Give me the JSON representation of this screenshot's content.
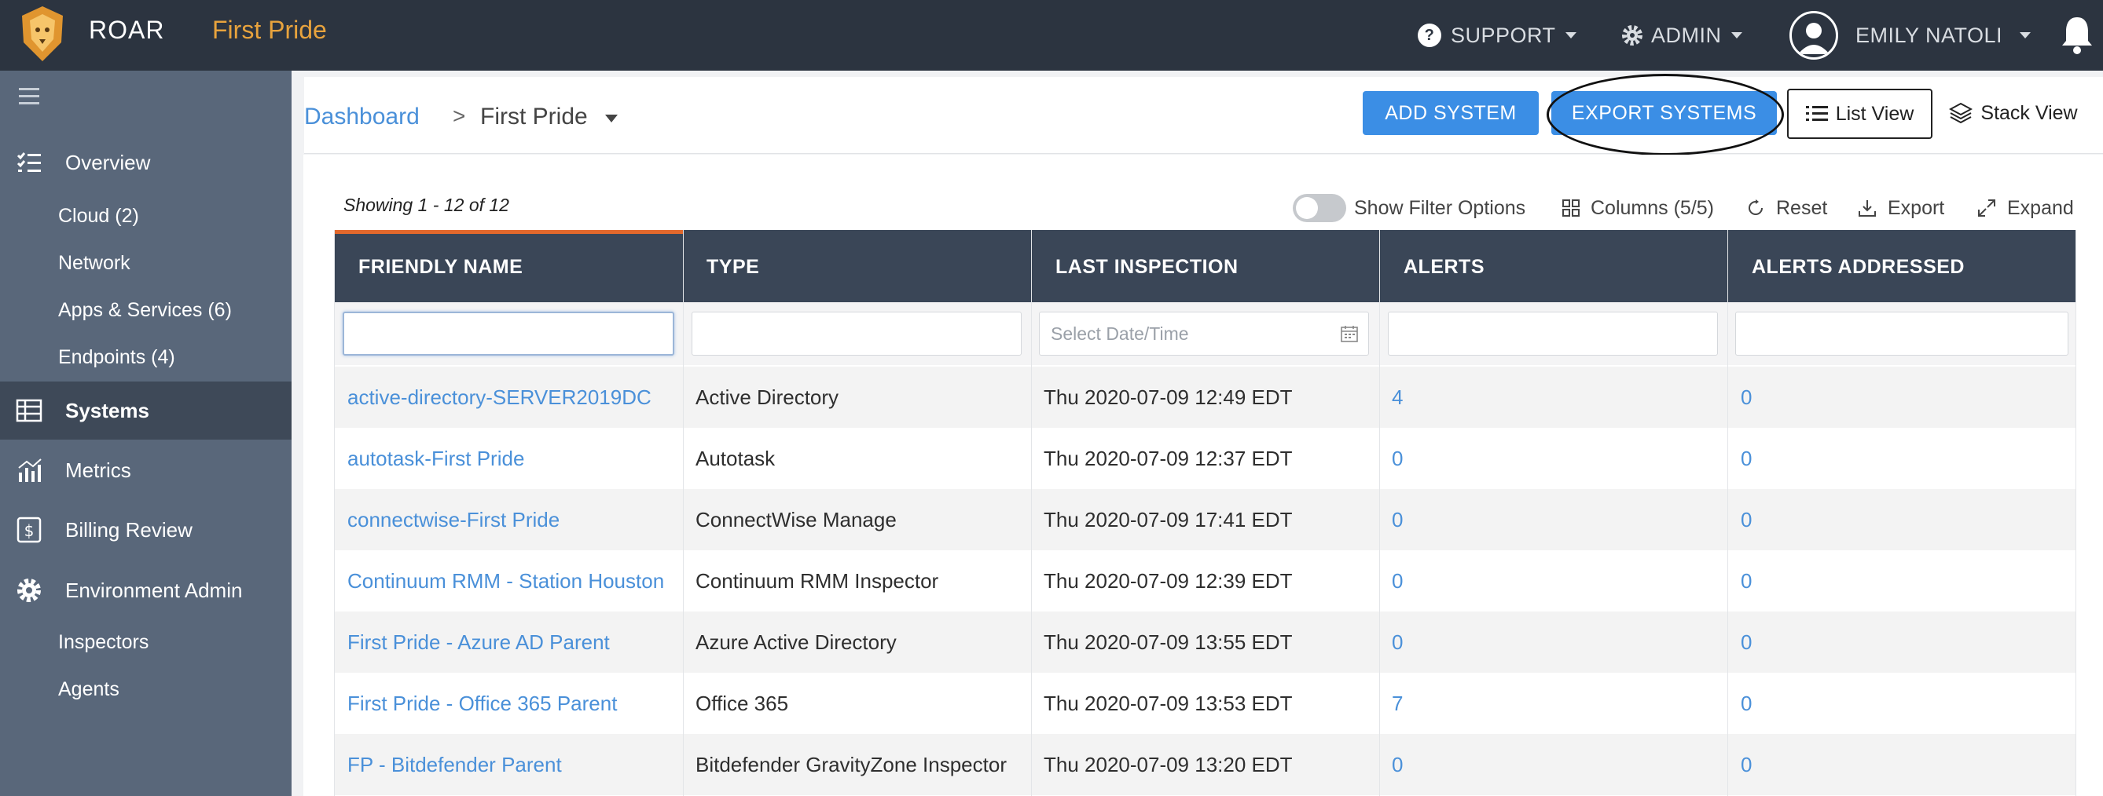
{
  "app": {
    "brand": "ROAR",
    "org": "First Pride"
  },
  "topnav": {
    "support": "SUPPORT",
    "admin": "ADMIN",
    "user": "EMILY NATOLI"
  },
  "sidebar": {
    "overview": "Overview",
    "sub_overview": [
      "Cloud (2)",
      "Network",
      "Apps & Services (6)",
      "Endpoints (4)"
    ],
    "systems": "Systems",
    "metrics": "Metrics",
    "billing": "Billing Review",
    "env_admin": "Environment Admin",
    "sub_env": [
      "Inspectors",
      "Agents"
    ]
  },
  "breadcrumb": {
    "root": "Dashboard",
    "sep": ">",
    "current": "First Pride"
  },
  "actions": {
    "add": "ADD SYSTEM",
    "export": "EXPORT SYSTEMS",
    "list_view": "List View",
    "stack_view": "Stack View"
  },
  "toolbar": {
    "showing": "Showing 1 - 12 of 12",
    "filter": "Show Filter Options",
    "columns": "Columns (5/5)",
    "reset": "Reset",
    "export": "Export",
    "expand": "Expand"
  },
  "table": {
    "headers": [
      "FRIENDLY NAME",
      "TYPE",
      "LAST INSPECTION",
      "ALERTS",
      "ALERTS ADDRESSED"
    ],
    "date_placeholder": "Select Date/Time",
    "rows": [
      {
        "name": "active-directory-SERVER2019DC",
        "type": "Active Directory",
        "last": "Thu 2020-07-09 12:49 EDT",
        "alerts": "4",
        "addressed": "0"
      },
      {
        "name": "autotask-First Pride",
        "type": "Autotask",
        "last": "Thu 2020-07-09 12:37 EDT",
        "alerts": "0",
        "addressed": "0"
      },
      {
        "name": "connectwise-First Pride",
        "type": "ConnectWise Manage",
        "last": "Thu 2020-07-09 17:41 EDT",
        "alerts": "0",
        "addressed": "0"
      },
      {
        "name": "Continuum RMM - Station Houston",
        "type": "Continuum RMM Inspector",
        "last": "Thu 2020-07-09 12:39 EDT",
        "alerts": "0",
        "addressed": "0"
      },
      {
        "name": "First Pride - Azure AD Parent",
        "type": "Azure Active Directory",
        "last": "Thu 2020-07-09 13:55 EDT",
        "alerts": "0",
        "addressed": "0"
      },
      {
        "name": "First Pride - Office 365 Parent",
        "type": "Office 365",
        "last": "Thu 2020-07-09 13:53 EDT",
        "alerts": "7",
        "addressed": "0"
      },
      {
        "name": "FP - Bitdefender Parent",
        "type": "Bitdefender GravityZone Inspector",
        "last": "Thu 2020-07-09 13:20 EDT",
        "alerts": "0",
        "addressed": "0"
      }
    ]
  }
}
